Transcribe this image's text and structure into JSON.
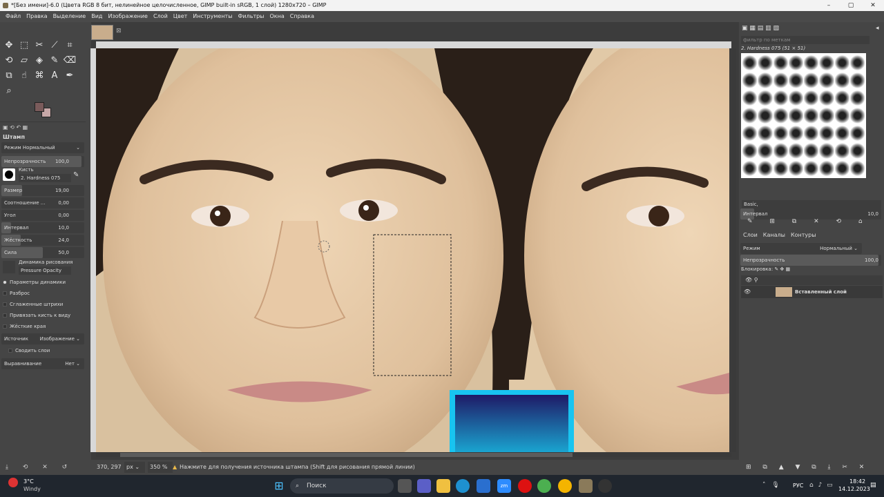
{
  "window": {
    "title": "*[Без имени]-6.0 (Цвета RGB 8 бит, нелинейное целочисленное, GIMP built-in sRGB, 1 слой) 1280x720 – GIMP",
    "controls": [
      "–",
      "▢",
      "✕"
    ]
  },
  "menu": [
    "Файл",
    "Правка",
    "Выделение",
    "Вид",
    "Изображение",
    "Слой",
    "Цвет",
    "Инструменты",
    "Фильтры",
    "Окна",
    "Справка"
  ],
  "toolbox": {
    "tools": [
      {
        "icon": "move-icon",
        "glyph": "✥"
      },
      {
        "icon": "rect-select-icon",
        "glyph": "⬚"
      },
      {
        "icon": "warp-icon",
        "glyph": "✂"
      },
      {
        "icon": "fuzzy-select-icon",
        "glyph": "⟋"
      },
      {
        "icon": "crop-icon",
        "glyph": "⌗"
      },
      {
        "icon": "rotate-icon",
        "glyph": "⟲"
      },
      {
        "icon": "perspective-icon",
        "glyph": "▱"
      },
      {
        "icon": "bucket-fill-icon",
        "glyph": "◈"
      },
      {
        "icon": "paintbrush-icon",
        "glyph": "✎"
      },
      {
        "icon": "eraser-icon",
        "glyph": "⌫"
      },
      {
        "icon": "clone-stamp-icon",
        "glyph": "⧉"
      },
      {
        "icon": "smudge-icon",
        "glyph": "☝"
      },
      {
        "icon": "paths-icon",
        "glyph": "⌘"
      },
      {
        "icon": "text-icon",
        "glyph": "A"
      },
      {
        "icon": "color-picker-icon",
        "glyph": "✒"
      },
      {
        "icon": "zoom-icon",
        "glyph": "⌕"
      }
    ],
    "fg_color": "#7a5b5b",
    "bg_color": "#c8a8a8"
  },
  "tool_options": {
    "title": "Штамп",
    "mode_label": "Режим",
    "mode_value": "Нормальный",
    "opacity_label": "Непрозрачность",
    "opacity_value": "100,0",
    "brush_label": "Кисть",
    "brush_name": "2. Hardness 075",
    "params": [
      {
        "label": "Размер",
        "value": "19,00"
      },
      {
        "label": "Соотношение ...",
        "value": "0,00"
      },
      {
        "label": "Угол",
        "value": "0,00"
      },
      {
        "label": "Интервал",
        "value": "10,0"
      },
      {
        "label": "Жёсткость",
        "value": "24,0"
      },
      {
        "label": "Сила",
        "value": "50,0"
      }
    ],
    "dynamics_label": "Динамика рисования",
    "dynamics_value": "Pressure Opacity",
    "dynamics_params_label": "Параметры динамики",
    "checks": [
      "Разброс",
      "Сглаженные штрихи",
      "Привязать кисть к виду",
      "Жёсткие края"
    ],
    "source_label": "Источник",
    "source_value": "Изображение",
    "merge_label": "Сводить слои",
    "align_label": "Выравнивание",
    "align_value": "Нет"
  },
  "status": {
    "coords": "370, 297",
    "unit": "px",
    "zoom": "350 %",
    "message": "Нажмите для получения источника штампа (Shift для рисования прямой линии)"
  },
  "brushes": {
    "filter_placeholder": "фильтр по меткам",
    "selected": "2. Hardness 075 (51 × 51)",
    "preset": "Basic,",
    "spacing_label": "Интервал",
    "spacing_value": "10,0"
  },
  "layers": {
    "tabs": [
      "Слои",
      "Каналы",
      "Контуры"
    ],
    "mode_label": "Режим",
    "mode_value": "Нормальный",
    "opacity_label": "Непрозрачность",
    "opacity_value": "100,0",
    "lock_label": "Блокировка:",
    "layer_name": "Вставленный слой"
  },
  "taskbar": {
    "weather_temp": "3°C",
    "weather_desc": "Windy",
    "search": "Поиск",
    "lang": "РУС",
    "time": "18:42",
    "date": "14.12.2023"
  }
}
